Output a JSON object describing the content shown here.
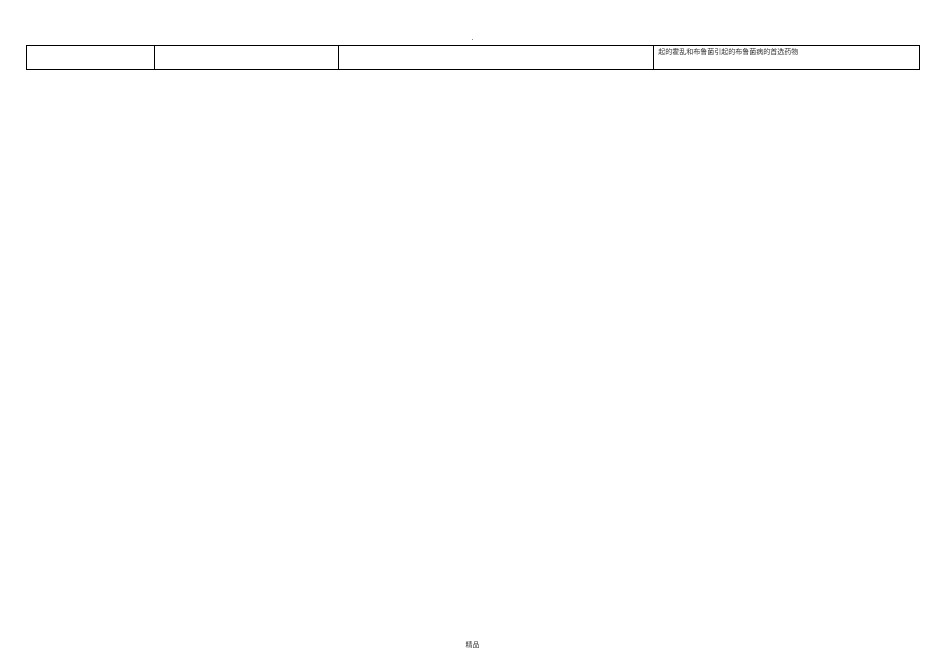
{
  "header": {
    "dot": "."
  },
  "table": {
    "row": {
      "col1": "",
      "col2": "",
      "col3": "",
      "col4": "起的霍乱和布鲁菌引起的布鲁菌病的首选药物"
    }
  },
  "footer": {
    "text": "精品"
  }
}
